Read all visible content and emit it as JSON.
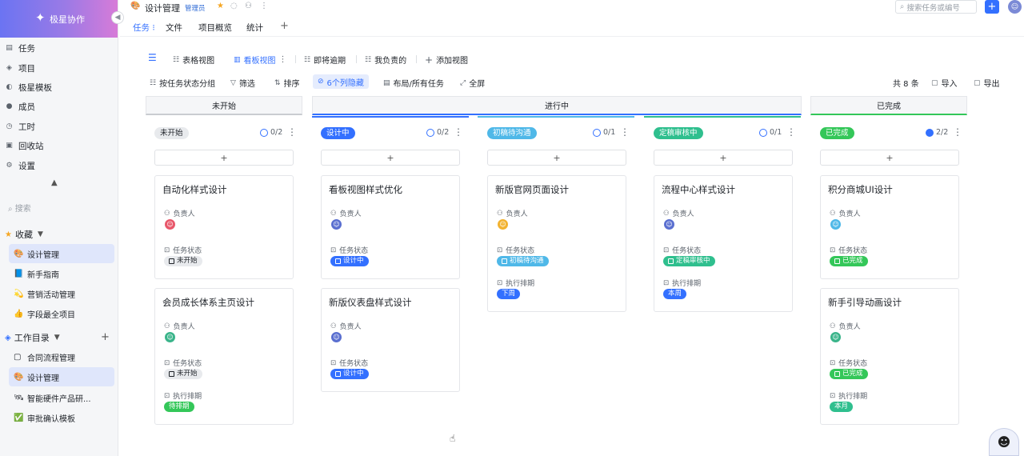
{
  "brand": {
    "name": "极星协作"
  },
  "sidebar": {
    "nav": [
      {
        "label": "任务",
        "icon": "task-icon"
      },
      {
        "label": "项目",
        "icon": "project-icon"
      },
      {
        "label": "极星模板",
        "icon": "template-icon"
      },
      {
        "label": "成员",
        "icon": "member-icon"
      },
      {
        "label": "工时",
        "icon": "clock-icon"
      },
      {
        "label": "回收站",
        "icon": "trash-icon"
      },
      {
        "label": "设置",
        "icon": "settings-icon"
      }
    ],
    "search_label": "搜索",
    "favorites": {
      "label": "收藏",
      "items": [
        {
          "label": "设计管理",
          "icon": "palette-icon"
        },
        {
          "label": "新手指南",
          "icon": "book-icon"
        },
        {
          "label": "营销活动管理",
          "icon": "megaphone-icon"
        },
        {
          "label": "字段最全项目",
          "icon": "thumbs-up-icon"
        }
      ]
    },
    "workspace": {
      "label": "工作目录",
      "items": [
        {
          "label": "合同流程管理",
          "icon": "document-icon"
        },
        {
          "label": "设计管理",
          "icon": "palette-icon"
        },
        {
          "label": "智能硬件产品研...",
          "icon": "satellite-icon"
        },
        {
          "label": "审批确认模板",
          "icon": "check-box-icon"
        }
      ]
    }
  },
  "header": {
    "title": "设计管理",
    "role": "管理员",
    "search_placeholder": "搜索任务或编号"
  },
  "tabs": {
    "prefix": "任务",
    "items": [
      "文件",
      "项目概览",
      "统计"
    ]
  },
  "views": [
    "表格视图",
    "看板视图",
    "即将逾期",
    "我负责的",
    "添加视图"
  ],
  "toolbar": {
    "group_by": "按任务状态分组",
    "filter": "筛选",
    "sort": "排序",
    "hidden": "6个列隐藏",
    "layout": "布局/所有任务",
    "fullscreen": "全屏",
    "total": "共 8 条",
    "import": "导入",
    "export": "导出"
  },
  "groups": [
    "未开始",
    "进行中",
    "已完成"
  ],
  "field_labels": {
    "owner": "负责人",
    "status": "任务状态",
    "schedule": "执行排期"
  },
  "colors": {
    "not_started": "#e8eaed",
    "designing": "#3370ff",
    "communicating": "#4fb8e8",
    "review": "#2fbf8e",
    "done": "#34c759",
    "schedule_week": "#3370ff",
    "schedule_pending": "#34c759"
  },
  "columns": [
    {
      "status": "未开始",
      "count": "0/2",
      "cards": [
        {
          "title": "自动化样式设计",
          "status": "未开始"
        },
        {
          "title": "会员成长体系主页设计",
          "status": "未开始",
          "schedule": "待排期"
        }
      ]
    },
    {
      "status": "设计中",
      "count": "0/2",
      "cards": [
        {
          "title": "看板视图样式优化",
          "status": "设计中"
        },
        {
          "title": "新版仪表盘样式设计",
          "status": "设计中"
        }
      ]
    },
    {
      "status": "初稿待沟通",
      "count": "0/1",
      "cards": [
        {
          "title": "新版官网页面设计",
          "status": "初稿待沟通",
          "schedule": "下周"
        }
      ]
    },
    {
      "status": "定稿审核中",
      "count": "0/1",
      "cards": [
        {
          "title": "流程中心样式设计",
          "status": "定稿审核中",
          "schedule": "本周"
        }
      ]
    },
    {
      "status": "已完成",
      "count": "2/2",
      "cards": [
        {
          "title": "积分商城UI设计",
          "status": "已完成"
        },
        {
          "title": "新手引导动画设计",
          "status": "已完成",
          "schedule": "本月"
        }
      ]
    }
  ]
}
